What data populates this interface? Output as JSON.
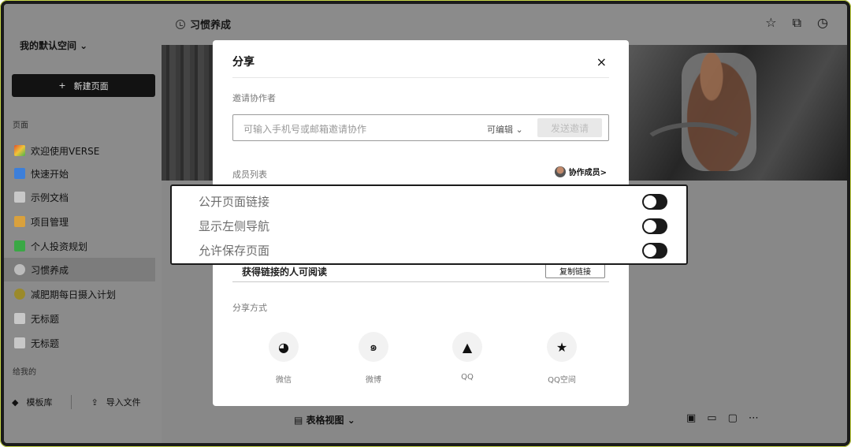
{
  "topbar": {
    "page_title": "习惯养成",
    "icons": [
      "star-icon",
      "open-external-icon",
      "clock-check-icon"
    ]
  },
  "sidebar": {
    "workspace": "我的默认空间 ⌄",
    "new_page": "新建页面",
    "pages_label": "页面",
    "items": [
      {
        "label": "欢迎使用VERSE",
        "icon": "rainbow-icon",
        "color": "#e0542c"
      },
      {
        "label": "快速开始",
        "icon": "fast-forward-icon",
        "color": "#3d7fd9"
      },
      {
        "label": "示例文档",
        "icon": "document-icon",
        "color": "#cccccc"
      },
      {
        "label": "项目管理",
        "icon": "folder-icon",
        "color": "#d9a13d"
      },
      {
        "label": "个人投资规划",
        "icon": "chart-icon",
        "color": "#3aa845"
      },
      {
        "label": "习惯养成",
        "icon": "clock-icon",
        "color": "#bbbbbb",
        "active": true
      },
      {
        "label": "减肥期每日摄入计划",
        "icon": "food-icon",
        "color": "#9b8a2a"
      },
      {
        "label": "无标题",
        "icon": "document-icon",
        "color": "#cccccc"
      },
      {
        "label": "无标题",
        "icon": "document-icon",
        "color": "#cccccc"
      }
    ],
    "shared_label": "给我的",
    "template_lib": "模板库",
    "import_file": "导入文件"
  },
  "page_toolbar": {
    "view": "表格视图 ⌄"
  },
  "modal": {
    "title": "分享",
    "close": "×",
    "invite_label": "邀请协作者",
    "invite_placeholder": "可输入手机号或邮箱邀请协作",
    "permission": "可编辑 ⌄",
    "send_button": "发送邀请",
    "members_label": "成员列表",
    "collaborators": "协作成员>",
    "link_text": "获得链接的人可阅读",
    "copy_link": "复制链接",
    "share_methods_label": "分享方式",
    "share_methods": [
      {
        "label": "微信",
        "icon": "wechat-icon",
        "glyph": "◕"
      },
      {
        "label": "微博",
        "icon": "weibo-icon",
        "glyph": "๑"
      },
      {
        "label": "QQ",
        "icon": "qq-icon",
        "glyph": "▲"
      },
      {
        "label": "QQ空间",
        "icon": "qzone-star-icon",
        "glyph": "★"
      }
    ]
  },
  "highlight": {
    "rows": [
      {
        "label": "公开页面链接",
        "toggle": true
      },
      {
        "label": "显示左侧导航",
        "toggle": true
      },
      {
        "label": "允许保存页面",
        "toggle": true
      }
    ]
  }
}
